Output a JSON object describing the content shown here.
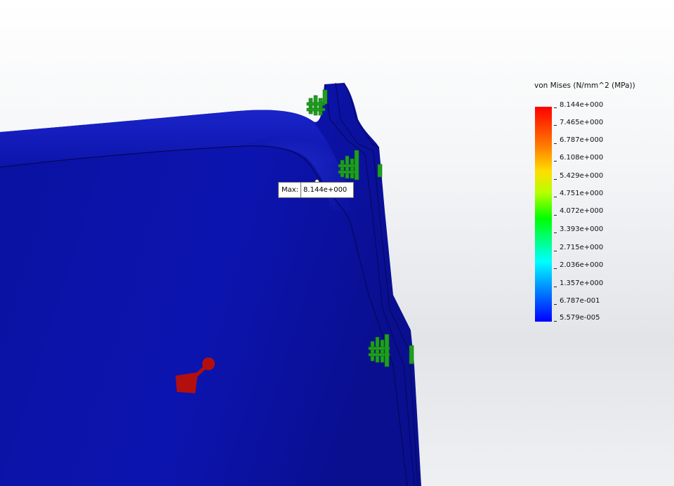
{
  "legend": {
    "title": "von Mises (N/mm^2 (MPa))",
    "colormap": [
      "#ff0000",
      "#ff7a00",
      "#ffdd00",
      "#b8ff00",
      "#00ff00",
      "#00ff80",
      "#00ffff",
      "#0090ff",
      "#0000ff"
    ],
    "labels": [
      "8.144e+000",
      "7.465e+000",
      "6.787e+000",
      "6.108e+000",
      "5.429e+000",
      "4.751e+000",
      "4.072e+000",
      "3.393e+000",
      "2.715e+000",
      "2.036e+000",
      "1.357e+000",
      "6.787e-001",
      "5.579e-005"
    ]
  },
  "probe": {
    "label": "Max:",
    "value": "8.144e+000"
  },
  "colors": {
    "model_body": "#0b12a8",
    "fixture": "#1fa01f",
    "load_arrow": "#b30f0f"
  }
}
